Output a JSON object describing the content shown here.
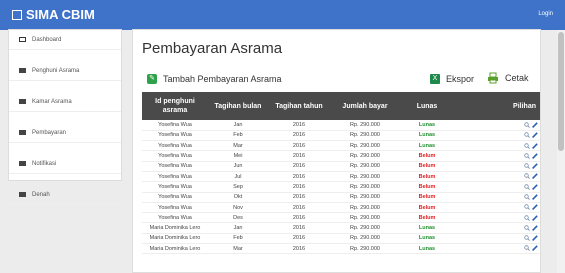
{
  "app": {
    "title": "SIMA CBIM",
    "login_label": "Login"
  },
  "sidebar": {
    "items": [
      {
        "label": "Dashboard",
        "icon": "monitor-icon",
        "color": "#333333"
      },
      {
        "label": "Penghuni Asrama",
        "icon": "list-icon",
        "color": "#444444"
      },
      {
        "label": "Kamar Asrama",
        "icon": "list-icon",
        "color": "#444444"
      },
      {
        "label": "Pembayaran",
        "icon": "list-icon",
        "color": "#444444"
      },
      {
        "label": "Notifikasi",
        "icon": "list-icon",
        "color": "#444444"
      },
      {
        "label": "Denah",
        "icon": "list-icon",
        "color": "#444444"
      }
    ]
  },
  "main": {
    "title": "Pembayaran Asrama",
    "add_label": "Tambah Pembayaran Asrama",
    "export_label": "Ekspor",
    "print_label": "Cetak"
  },
  "table": {
    "headers": [
      "Id penghuni asrama",
      "Tagihan bulan",
      "Tagihan tahun",
      "Jumlah bayar",
      "Lunas",
      "Pilihan"
    ],
    "rows": [
      {
        "id": "Yosefina Wua",
        "bulan": "Jan",
        "tahun": "2016",
        "jumlah": "Rp. 290.000",
        "lunas": "Lunas"
      },
      {
        "id": "Yosefina Wua",
        "bulan": "Feb",
        "tahun": "2016",
        "jumlah": "Rp. 290.000",
        "lunas": "Lunas"
      },
      {
        "id": "Yosefina Wua",
        "bulan": "Mar",
        "tahun": "2016",
        "jumlah": "Rp. 290.000",
        "lunas": "Lunas"
      },
      {
        "id": "Yosefina Wua",
        "bulan": "Mei",
        "tahun": "2016",
        "jumlah": "Rp. 290.000",
        "lunas": "Belum"
      },
      {
        "id": "Yosefina Wua",
        "bulan": "Jun",
        "tahun": "2016",
        "jumlah": "Rp. 290.000",
        "lunas": "Belum"
      },
      {
        "id": "Yosefina Wua",
        "bulan": "Jul",
        "tahun": "2016",
        "jumlah": "Rp. 290.000",
        "lunas": "Belum"
      },
      {
        "id": "Yosefina Wua",
        "bulan": "Sep",
        "tahun": "2016",
        "jumlah": "Rp. 290.000",
        "lunas": "Belum"
      },
      {
        "id": "Yosefina Wua",
        "bulan": "Okt",
        "tahun": "2016",
        "jumlah": "Rp. 290.000",
        "lunas": "Belum"
      },
      {
        "id": "Yosefina Wua",
        "bulan": "Nov",
        "tahun": "2016",
        "jumlah": "Rp. 290.000",
        "lunas": "Belum"
      },
      {
        "id": "Yosefina Wua",
        "bulan": "Des",
        "tahun": "2016",
        "jumlah": "Rp. 290.000",
        "lunas": "Belum"
      },
      {
        "id": "Maria Dominika Lero",
        "bulan": "Jan",
        "tahun": "2016",
        "jumlah": "Rp. 290.000",
        "lunas": "Lunas"
      },
      {
        "id": "Maria Dominika Lero",
        "bulan": "Feb",
        "tahun": "2016",
        "jumlah": "Rp. 290.000",
        "lunas": "Lunas"
      },
      {
        "id": "Maria Dominika Lero",
        "bulan": "Mar",
        "tahun": "2016",
        "jumlah": "Rp. 290.000",
        "lunas": "Lunas"
      }
    ]
  },
  "colors": {
    "brand": "#3e73c9",
    "lunas": "#1f8f2f",
    "belum": "#e01f1f",
    "header_bg": "#4a4a4a"
  }
}
